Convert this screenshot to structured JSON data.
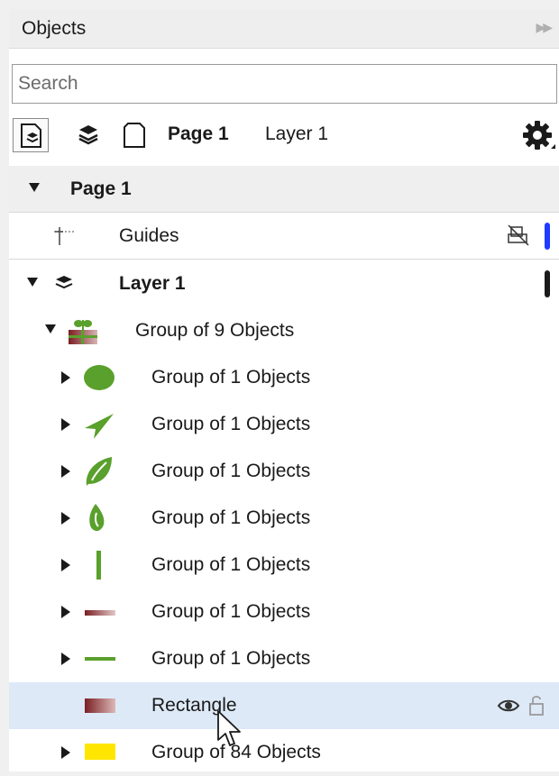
{
  "panel": {
    "title": "Objects",
    "expand_icon": "double-chevron-right-icon"
  },
  "search": {
    "placeholder": "Search",
    "value": ""
  },
  "toolbar": {
    "page_label": "Page 1",
    "layer_label": "Layer 1",
    "icons": [
      "page-layer-view-icon",
      "layers-icon",
      "page-icon",
      "gear-icon"
    ]
  },
  "tree": {
    "page": {
      "label": "Page 1"
    },
    "guides": {
      "label": "Guides",
      "bar_color": "#1f3bff"
    },
    "layer": {
      "label": "Layer 1",
      "bar_color": "#1a1a1a"
    },
    "group9": {
      "label": "Group of 9 Objects"
    },
    "children": [
      {
        "label": "Group of 1 Objects",
        "icon": "ellipse-icon",
        "color": "#5aa02c"
      },
      {
        "label": "Group of 1 Objects",
        "icon": "paper-plane-shape-icon",
        "color": "#5aa02c"
      },
      {
        "label": "Group of 1 Objects",
        "icon": "leaf-icon",
        "color": "#5aa02c"
      },
      {
        "label": "Group of 1 Objects",
        "icon": "teardrop-icon",
        "color": "#5aa02c"
      },
      {
        "label": "Group of 1 Objects",
        "icon": "vertical-line-icon",
        "color": "#5aa02c"
      },
      {
        "label": "Group of 1 Objects",
        "icon": "gradient-line-icon",
        "color": "#8b2a2a"
      },
      {
        "label": "Group of 1 Objects",
        "icon": "horizontal-line-icon",
        "color": "#5aa02c"
      }
    ],
    "rectangle": {
      "label": "Rectangle",
      "color": "#7a1f22"
    },
    "group84": {
      "label": "Group of 84 Objects",
      "color": "#ffe600"
    }
  },
  "colors": {
    "selected_row": "#dde9f7",
    "header_bg": "#eeeeee"
  }
}
